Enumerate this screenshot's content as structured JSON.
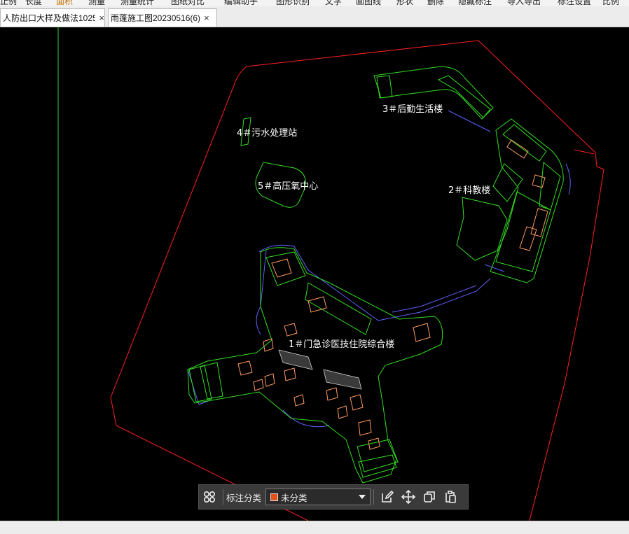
{
  "menu": [
    {
      "label": "止例"
    },
    {
      "label": "长度"
    },
    {
      "label": "面积",
      "active": true
    },
    {
      "label": "测量"
    },
    {
      "label": "测量统计"
    },
    {
      "label": "图纸对比"
    },
    {
      "label": "编辑助手"
    },
    {
      "label": "图形识别"
    },
    {
      "label": "文字"
    },
    {
      "label": "画图线"
    },
    {
      "label": "形状"
    },
    {
      "label": "删除"
    },
    {
      "label": "隐藏标注"
    },
    {
      "label": "导入导出"
    },
    {
      "label": "标注设置"
    },
    {
      "label": "比例"
    }
  ],
  "tabs": [
    {
      "label": "人防出口大样及做法1025",
      "close": "×"
    },
    {
      "label": "雨蓬施工图20230516(6)",
      "close": "×"
    }
  ],
  "drawing": {
    "labels": {
      "building3": "3＃后勤生活楼",
      "building4": "4＃污水处理站",
      "building5": "5＃高压氧中心",
      "building2": "2＃科教楼",
      "building1": "1＃门急诊医技住院综合楼"
    }
  },
  "toolbar": {
    "label": "标注分类",
    "category_value": "未分类",
    "category_color": "#e8501a"
  },
  "colors": {
    "boundary": "#ff2020",
    "building": "#33dd22",
    "road": "#6060ff",
    "detail": "#ff9a60",
    "axis": "#39d12c"
  }
}
